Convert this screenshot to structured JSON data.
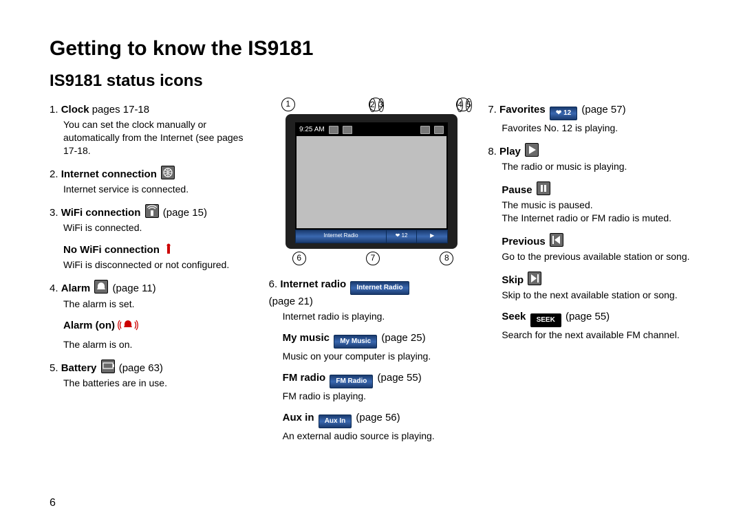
{
  "title": "Getting to know the IS9181",
  "subtitle": "IS9181 status icons",
  "page_number": "6",
  "callouts_top": [
    "1",
    "2",
    "3",
    "4",
    "5"
  ],
  "callouts_bottom": [
    "6",
    "7",
    "8"
  ],
  "device": {
    "clock": "9:25 AM",
    "bottom_segments": [
      "Internet Radio",
      "12",
      ""
    ],
    "fav_num": "12"
  },
  "left": [
    {
      "n": "1.",
      "title": "Clock",
      "tail": " pages 17-18",
      "desc": "You can set the clock manually or automatically from the Internet (see pages 17-18."
    },
    {
      "n": "2.",
      "title": "Internet connection",
      "icon": "globe-icon",
      "tail": "",
      "desc": "Internet service is connected."
    },
    {
      "n": "3.",
      "title": "WiFi connection",
      "icon": "wifi-icon",
      "tail": " (page 15)",
      "desc": "WiFi is connected."
    },
    {
      "sub": true,
      "title": "No WiFi connection",
      "icon": "no-wifi-icon",
      "icon_red": true,
      "desc": "WiFi is disconnected or not configured."
    },
    {
      "n": "4.",
      "title": "Alarm",
      "icon": "alarm-icon",
      "tail": " (page 11)",
      "desc": "The alarm is set."
    },
    {
      "sub": true,
      "title": "Alarm (on)",
      "icon": "alarm-on-icon",
      "icon_red": true,
      "desc": "The alarm is on."
    },
    {
      "n": "5.",
      "title": "Battery",
      "icon": "battery-icon",
      "tail": " (page 63)",
      "desc": "The batteries are in use."
    }
  ],
  "mid": [
    {
      "n": "6.",
      "title": "Internet radio",
      "pill": "Internet Radio",
      "tail": "(page 21)",
      "tail_break": true,
      "desc": "Internet radio is playing."
    },
    {
      "sub": true,
      "title": "My music",
      "pill": "My Music",
      "tail": " (page 25)",
      "desc": "Music on your computer is playing."
    },
    {
      "sub": true,
      "title": "FM radio",
      "pill": "FM Radio",
      "tail": " (page 55)",
      "desc": "FM radio is playing."
    },
    {
      "sub": true,
      "title": "Aux in",
      "pill": "Aux In",
      "tail": " (page 56)",
      "desc": "An external audio source is playing."
    }
  ],
  "right": [
    {
      "n": "7.",
      "title": "Favorites",
      "pill": "12",
      "pill_heart": true,
      "tail": " (page 57)",
      "desc": "Favorites No. 12 is playing."
    },
    {
      "n": "8.",
      "title": "Play",
      "icon": "play-icon",
      "tail": "",
      "desc": "The radio or music is playing."
    },
    {
      "sub": true,
      "title": "Pause",
      "icon": "pause-icon",
      "tail": "",
      "desc": "The music is paused.\nThe Internet radio or FM radio is muted."
    },
    {
      "sub": true,
      "title": "Previous",
      "icon": "prev-icon",
      "tail": "",
      "desc": "Go to the previous available station or song."
    },
    {
      "sub": true,
      "title": "Skip",
      "icon": "skip-icon",
      "tail": "",
      "desc": "Skip to the next available station or song."
    },
    {
      "sub": true,
      "title": "Seek",
      "pill": "SEEK",
      "pill_black": true,
      "tail": " (page 55)",
      "desc": "Search for the next available FM channel."
    }
  ]
}
